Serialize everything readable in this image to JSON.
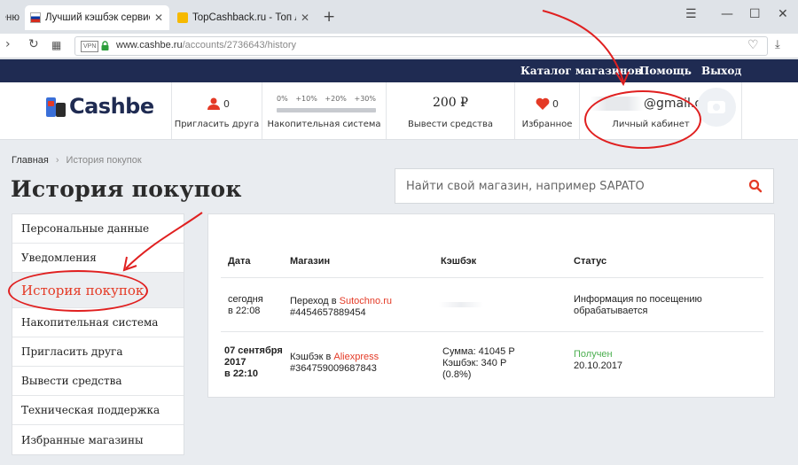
{
  "browser": {
    "tabs": [
      {
        "title": "Меню"
      },
      {
        "title": "Лучший кэшбэк сервис С"
      },
      {
        "title": "TopCashback.ru - Топ луч"
      }
    ],
    "new_tab": "+",
    "address": {
      "vpn": "VPN",
      "host": "www.cashbe.ru",
      "path": "/accounts/2736643/history"
    }
  },
  "topnav": {
    "catalog": "Каталог магазинов",
    "help": "Помощь",
    "logout": "Выход"
  },
  "header": {
    "logo": "Cashbe",
    "invite": {
      "count": "0",
      "label": "Пригласить друга"
    },
    "cumulative": {
      "levels": [
        "0%",
        "+10%",
        "+20%",
        "+30%"
      ],
      "label": "Накопительная система",
      "progress": 0
    },
    "balance": {
      "value": "200 ₽",
      "label": "Вывести средства"
    },
    "favorites": {
      "count": "0",
      "label": "Избранное"
    },
    "account": {
      "email": "@gmail.c",
      "label": "Личный кабинет"
    }
  },
  "breadcrumb": {
    "home": "Главная",
    "separator": "›",
    "current": "История покупок"
  },
  "page_title": "История покупок",
  "search": {
    "placeholder": "Найти свой магазин, например SAPATO"
  },
  "sidebar": {
    "items": [
      {
        "label": "Персональные данные"
      },
      {
        "label": "Уведомления"
      },
      {
        "label": "История покупок"
      },
      {
        "label": "Накопительная система"
      },
      {
        "label": "Пригласить друга"
      },
      {
        "label": "Вывести средства"
      },
      {
        "label": "Техническая поддержка"
      },
      {
        "label": "Избранные магазины"
      }
    ]
  },
  "history": {
    "columns": [
      "Дата",
      "Магазин",
      "Кэшбэк",
      "Статус"
    ],
    "rows": [
      {
        "date": [
          "сегодня",
          "в 22:08"
        ],
        "shop_prefix": "Переход в ",
        "shop_name": "Sutochno.ru",
        "shop_id": "#4454657889454",
        "cashback": [],
        "status": [
          "Информация по посещению",
          "обрабатывается"
        ]
      },
      {
        "date": [
          "07 сентября",
          "2017",
          "в 22:10"
        ],
        "shop_prefix": "Кэшбэк в ",
        "shop_name": "Aliexpress",
        "shop_id": "#364759009687843",
        "cashback": [
          "Сумма: 41045 Р",
          "Кэшбэк: 340 Р",
          "(0.8%)"
        ],
        "status": [
          "Получен",
          "20.10.2017"
        ]
      }
    ]
  },
  "colors": {
    "brand_navy": "#1f2b52",
    "accent_red": "#e43a26",
    "status_green": "#4caf50",
    "annotation_red": "#e02020"
  },
  "icons": [
    "back-icon",
    "reload-icon",
    "grid-icon",
    "lock-icon",
    "heart-outline-icon",
    "download-icon",
    "person-icon",
    "heart-icon",
    "camera-icon",
    "search-icon"
  ]
}
